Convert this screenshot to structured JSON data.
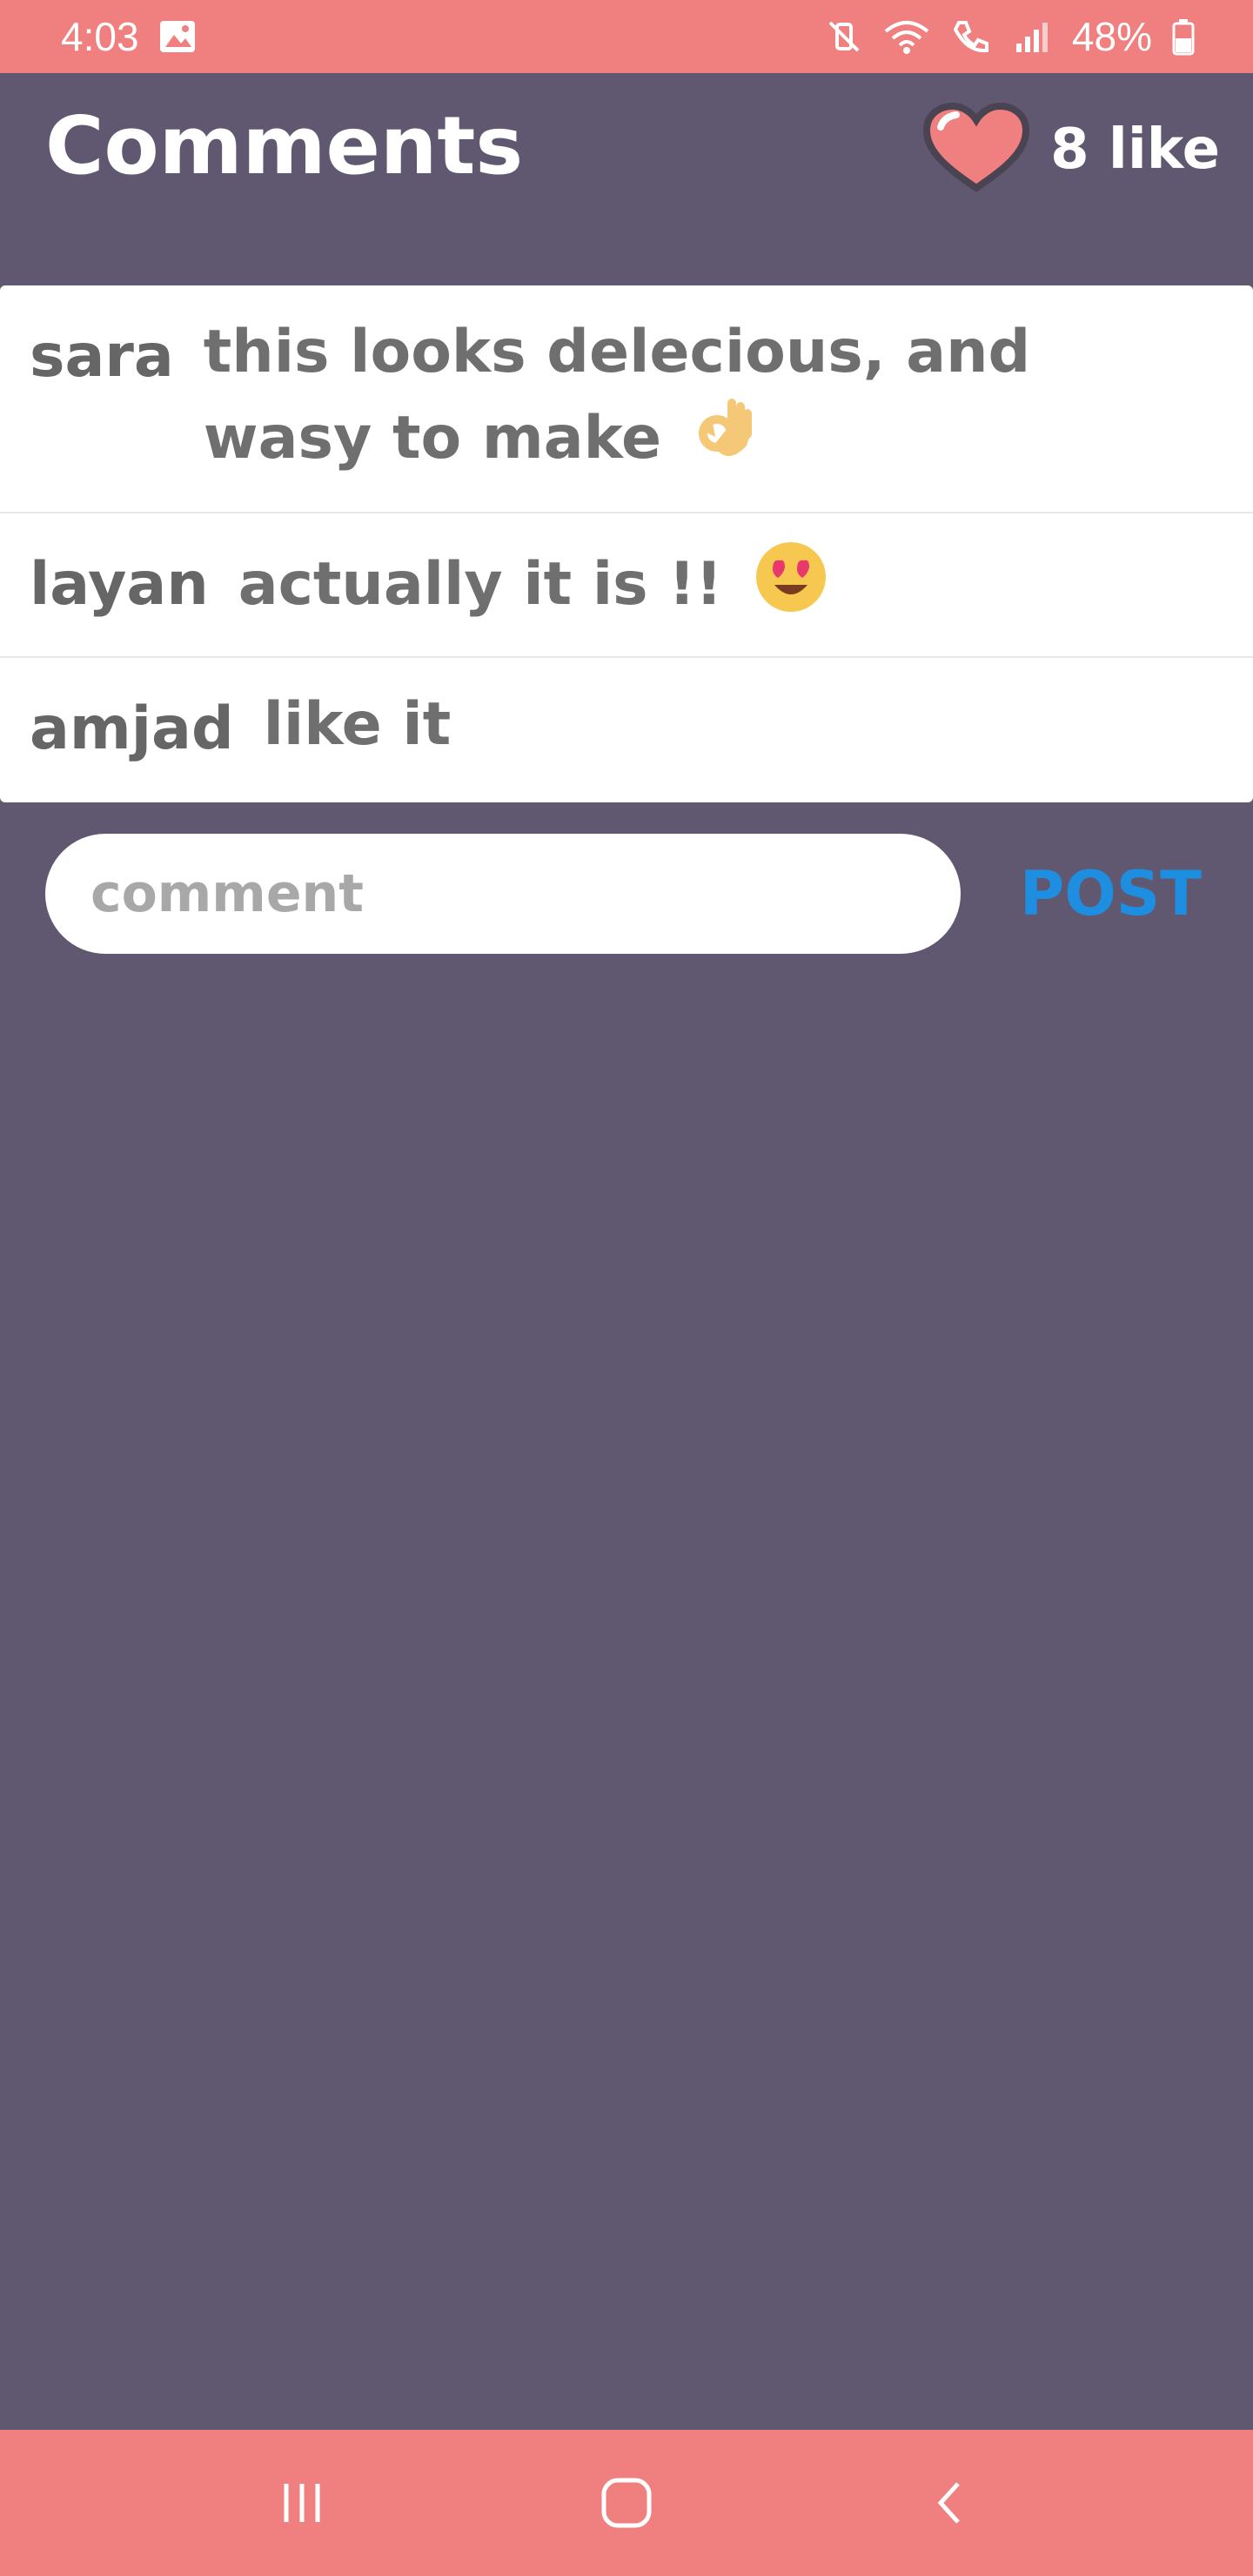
{
  "status_bar": {
    "time": "4:03",
    "battery": "48%",
    "icons": [
      "gallery-icon",
      "mute-icon",
      "wifi-icon",
      "wifi-calling-icon",
      "signal-icon",
      "battery-icon"
    ]
  },
  "header": {
    "title": "Comments",
    "like_count": "8 like",
    "like_icon": "heart-icon"
  },
  "comments": [
    {
      "user": "sara",
      "text": "this looks delecious, and wasy to make",
      "emoji": "ok-hand"
    },
    {
      "user": "layan",
      "text": "actually it is !!",
      "emoji": "heart-eyes"
    },
    {
      "user": "amjad",
      "text": "like it",
      "emoji": ""
    }
  ],
  "composer": {
    "placeholder": "comment",
    "value": "",
    "post_label": "POST"
  },
  "nav_bar": {
    "buttons": [
      "recent-apps-icon",
      "home-icon",
      "back-icon"
    ]
  },
  "colors": {
    "accent_bars": "#f07f7f",
    "background": "#605770",
    "post_button": "#1e8fe0",
    "heart": "#f07f7f"
  }
}
